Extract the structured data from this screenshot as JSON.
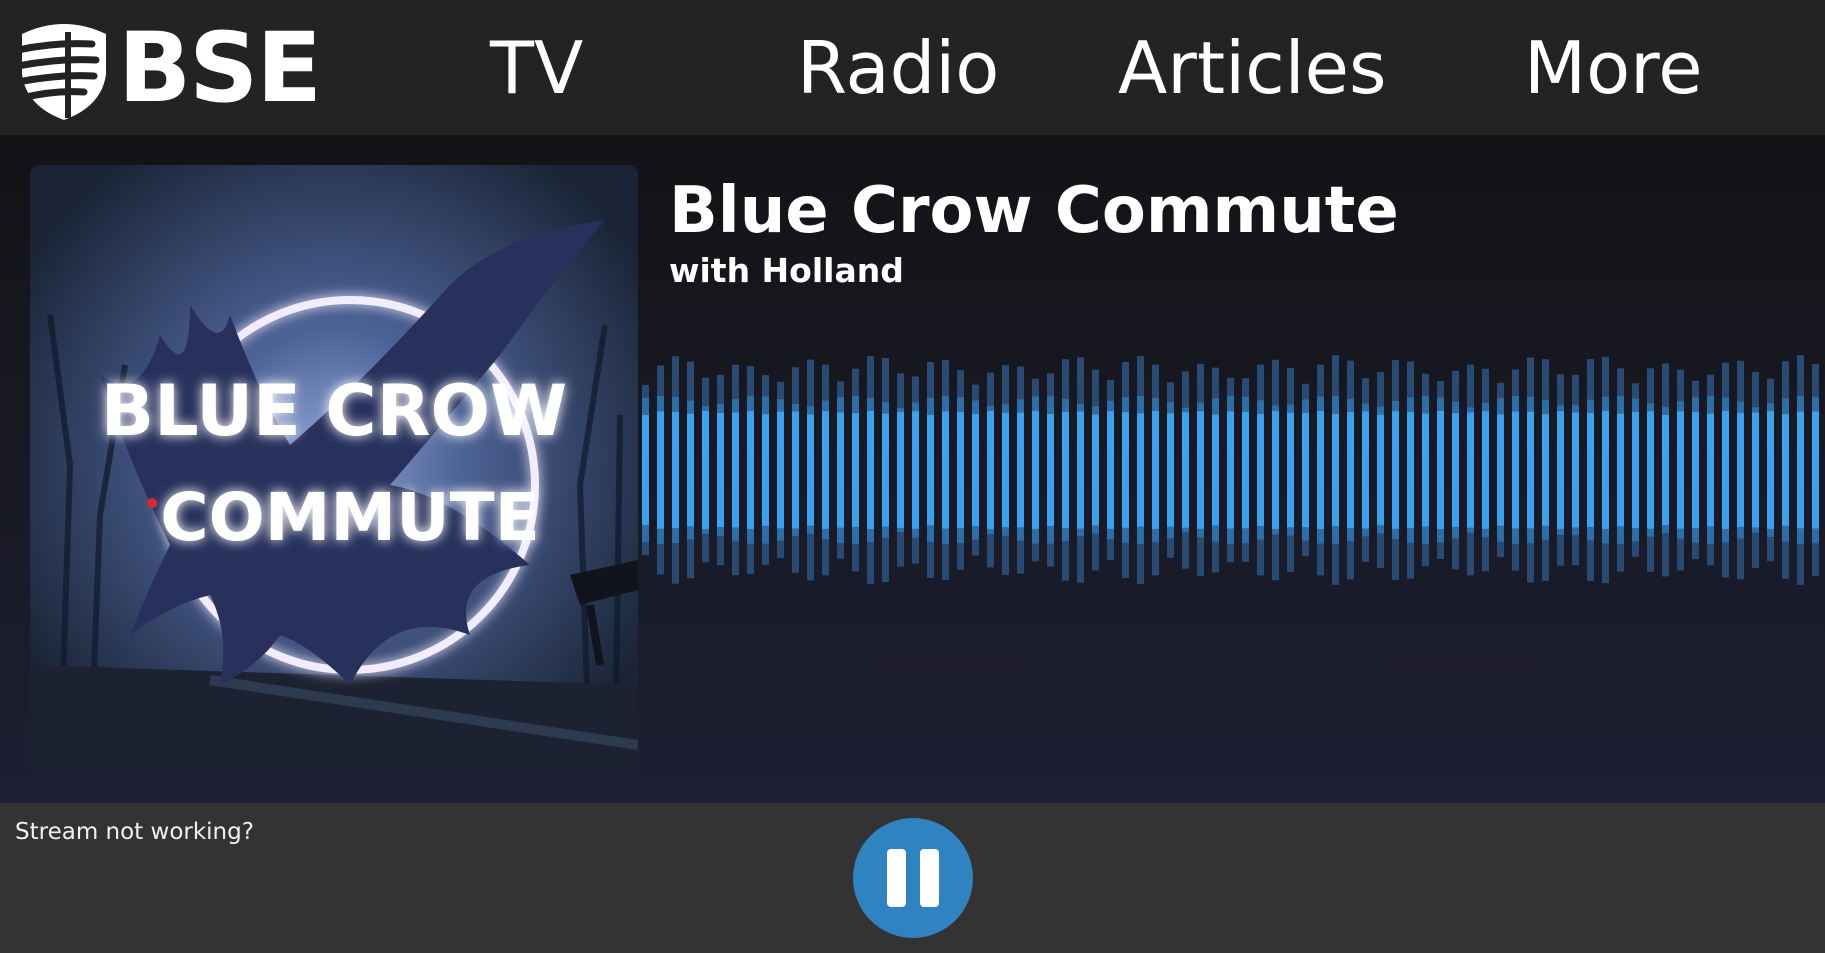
{
  "header": {
    "logo_text": "BSE",
    "nav": [
      "TV",
      "Radio",
      "Articles",
      "More"
    ]
  },
  "show": {
    "title": "Blue Crow Commute",
    "host": "with Holland",
    "cover_text_line1": "BLUE CROW",
    "cover_text_line2": "COMMUTE"
  },
  "footer": {
    "stream_help": "Stream not working?",
    "play_state": "pause"
  },
  "colors": {
    "accent": "#2f83c0",
    "wave_core": "#3aa3f0",
    "wave_mid": "#2c6fa8",
    "wave_outer": "#284a73"
  }
}
